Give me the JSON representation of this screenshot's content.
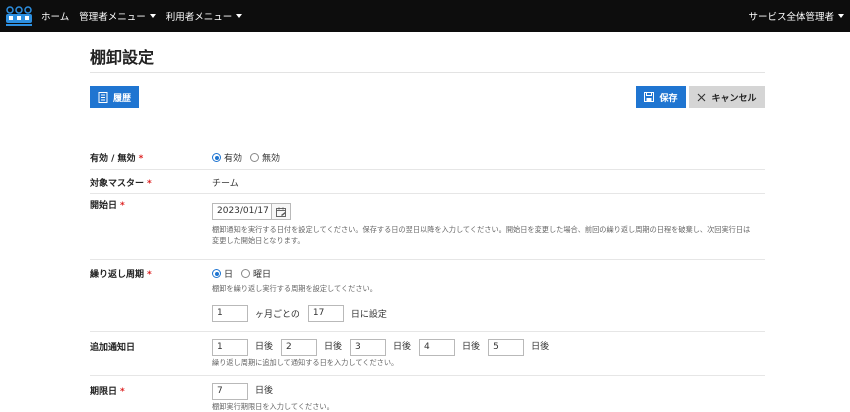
{
  "nav": {
    "home": "ホーム",
    "admin_menu": "管理者メニュー",
    "user_menu": "利用者メニュー",
    "account": "サービス全体管理者"
  },
  "page": {
    "title": "棚卸設定"
  },
  "toolbar": {
    "history_label": "履歴",
    "save_label": "保存",
    "cancel_label": "キャンセル"
  },
  "form": {
    "enabled": {
      "label": "有効 / 無効",
      "required": "*",
      "options": [
        "有効",
        "無効"
      ],
      "selected": "有効"
    },
    "target_master": {
      "label": "対象マスター",
      "required": "*",
      "value": "チーム"
    },
    "start_date": {
      "label": "開始日",
      "required": "*",
      "value": "2023/01/17",
      "help": "棚卸通知を実行する日付を設定してください。保存する日の翌日以降を入力してください。開始日を変更した場合、前回の繰り返し周期の日程を破棄し、次回実行日は変更した開始日となります。"
    },
    "repeat_cycle": {
      "label": "繰り返し周期",
      "required": "*",
      "options": [
        "日",
        "曜日"
      ],
      "selected": "日",
      "help": "棚卸を繰り返し実行する周期を設定してください。",
      "months_value": "1",
      "months_unit": "ヶ月ごとの",
      "day_value": "17",
      "day_unit": "日に設定"
    },
    "extra_notice": {
      "label": "追加通知日",
      "values": [
        "1",
        "2",
        "3",
        "4",
        "5"
      ],
      "unit": "日後",
      "help": "繰り返し周期に追加して通知する日を入力してください。"
    },
    "deadline": {
      "label": "期限日",
      "required": "*",
      "value": "7",
      "unit": "日後",
      "help": "棚卸実行期限日を入力してください。"
    }
  },
  "colors": {
    "primary": "#1f75d1",
    "topbar": "#0d0d0d",
    "required": "#dd2222"
  }
}
